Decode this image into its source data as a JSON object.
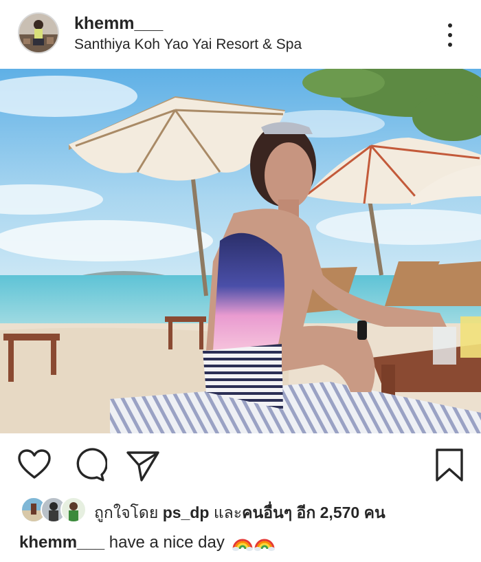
{
  "post": {
    "username": "khemm___",
    "location": "Santhiya Koh Yao Yai Resort & Spa"
  },
  "icons": {
    "more": "more-vertical-icon",
    "like": "heart-icon",
    "comment": "comment-icon",
    "share": "send-icon",
    "save": "bookmark-icon",
    "caption_emoji": "rainbow-icon"
  },
  "likes": {
    "prefix": "ถูกใจโดย",
    "user": "ps_dp",
    "and": "และ",
    "others": "คนอื่นๆ อีก 2,570 คน"
  },
  "caption": {
    "user": "khemm___",
    "text": "have a nice day"
  },
  "colors": {
    "text": "#262626",
    "sky": "#8cc7ea",
    "sea": "#4cbad0",
    "sand": "#ede0cd"
  }
}
